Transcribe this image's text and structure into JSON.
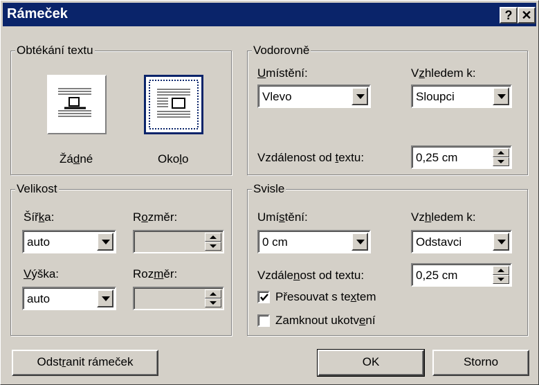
{
  "window": {
    "title": "Rámeček",
    "help_label": "?",
    "close_label": "✕"
  },
  "wrap": {
    "legend": "Obtékání textu",
    "none_label_pre": "Žá",
    "none_label_u": "d",
    "none_label_post": "né",
    "around_label_pre": "Oko",
    "around_label_u": "l",
    "around_label_post": "o",
    "selected": "around"
  },
  "horizontal": {
    "legend": "Vodorovně",
    "position_label_u": "U",
    "position_label_post": "místění:",
    "position_value": "Vlevo",
    "relative_label_pre": "V",
    "relative_label_u": "z",
    "relative_label_post": "hledem k:",
    "relative_value": "Sloupci",
    "distance_label_pre": "Vzdálenost od ",
    "distance_label_u": "t",
    "distance_label_post": "extu:",
    "distance_value": "0,25 cm"
  },
  "size": {
    "legend": "Velikost",
    "width_label_pre": "Šíř",
    "width_label_u": "k",
    "width_label_post": "a:",
    "width_value": "auto",
    "width_dim_label_pre": "R",
    "width_dim_label_u": "o",
    "width_dim_label_post": "změr:",
    "width_dim_value": "",
    "height_label_u": "V",
    "height_label_post": "ýška:",
    "height_value": "auto",
    "height_dim_label_pre": "Roz",
    "height_dim_label_u": "m",
    "height_dim_label_post": "ěr:",
    "height_dim_value": ""
  },
  "vertical": {
    "legend": "Svisle",
    "position_label_pre": "Umí",
    "position_label_u": "s",
    "position_label_post": "tění:",
    "position_value": "0 cm",
    "relative_label_pre": "Vz",
    "relative_label_u": "h",
    "relative_label_post": "ledem k:",
    "relative_value": "Odstavci",
    "distance_label_pre": "Vzdále",
    "distance_label_u": "n",
    "distance_label_post": "ost od textu:",
    "distance_value": "0,25 cm",
    "move_label_pre": "Přesouvat s te",
    "move_label_u": "x",
    "move_label_post": "tem",
    "move_checked": true,
    "lock_label_pre": "Zamknout ukotv",
    "lock_label_u": "e",
    "lock_label_post": "ní",
    "lock_checked": false
  },
  "buttons": {
    "remove_pre": "Odst",
    "remove_u": "r",
    "remove_post": "anit rámeček",
    "ok": "OK",
    "cancel": "Storno"
  }
}
